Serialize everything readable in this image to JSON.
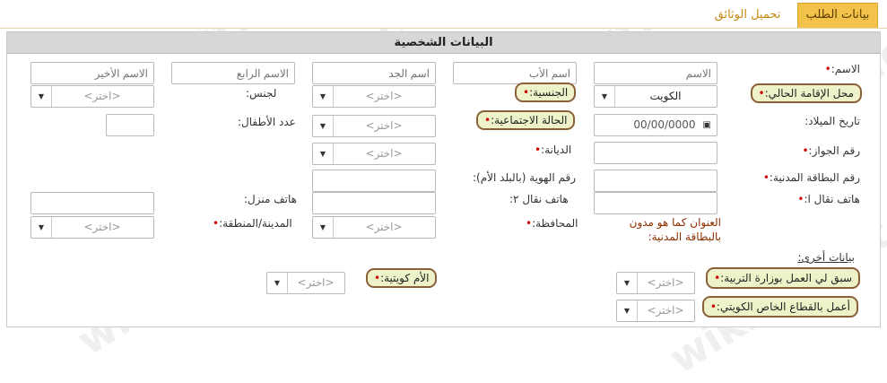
{
  "tabs": {
    "active": "بيانات الطلب",
    "second": "تحميل الوثائق"
  },
  "section_title": "البيانات الشخصية",
  "labels": {
    "name": "الاسم:",
    "residence": "محل الإقامة الحالي:",
    "nationality": "الجنسية:",
    "gender": "لجنس:",
    "dob": "تاريخ الميلاد:",
    "marital": "الحالة الاجتماعية:",
    "children": "عدد الأطفال:",
    "passport": "رقم الجواز:",
    "religion": "الديانة:",
    "civil_id": "رقم البطاقة المدنية:",
    "home_id": "رقم الهوية (بالبلد الأم):",
    "mobile1": "هاتف نقال ا:",
    "mobile2": "هاتف نقال ٢:",
    "home_phone": "هاتف منزل:",
    "address": "العنوان كما هو مدون بالبطاقة المدنية:",
    "governorate": "المحافظة:",
    "city": "المدينة/المنطقة:",
    "other_data": "بيانات أخرى:",
    "mother_kuwaiti": "الأم كويتية:",
    "prior_moe": "سبق لي العمل بوزارة التربية:",
    "private_sector": "أعمل بالقطاع الخاص الكويتي:"
  },
  "placeholders": {
    "first_name": "الاسم",
    "father_name": "اسم الأب",
    "grandfather_name": "اسم الجد",
    "fourth_name": "الاسم الرابع",
    "last_name": "الاسم الأخير"
  },
  "values": {
    "residence": "الكويت",
    "dob": "00/00/0000",
    "choose": "<اختر>"
  },
  "watermark": "wikikuwait.com"
}
